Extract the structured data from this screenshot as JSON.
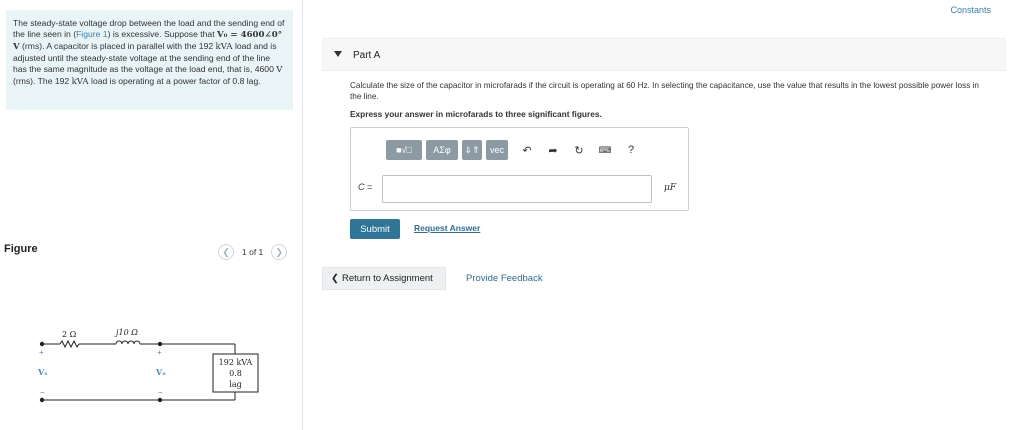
{
  "problem": {
    "text_1": "The steady-state voltage drop between the load and the sending end of the line seen in (",
    "figure_link": "Figure 1",
    "text_2": ") is excessive. Suppose that ",
    "text_3": "V₀ = 4600∠0° V",
    "text_4": " (rms). A capacitor is placed in parallel with the 192 ",
    "text_5": "kVA",
    "text_6": " load and is adjusted until the steady-state voltage at the sending end of the line has the same magnitude as the voltage at the load end, that is, 4600 ",
    "text_7": "V",
    "text_8": " (rms). The 192 ",
    "text_9": "kVA",
    "text_10": " load is operating at a power factor of 0.8 lag."
  },
  "figure": {
    "title": "Figure",
    "pager_text": "1 of 1",
    "prev_icon": "chevron-left-icon",
    "next_icon": "chevron-right-icon",
    "circuit": {
      "r_label": "2 Ω",
      "x_label": "j10 Ω",
      "vs_label": "Vₛ",
      "vo_label": "Vₒ",
      "plus": "+",
      "minus": "−",
      "load_line1": "192 kVA",
      "load_line2": "0.8",
      "load_line3": "lag"
    }
  },
  "header": {
    "constants_link": "Constants"
  },
  "part": {
    "label": "Part A",
    "question": "Calculate the size of the capacitor in microfarads if the circuit is operating at 60 Hz. In selecting the capacitance, use the value that results in the lowest possible power loss in the line.",
    "instruction": "Express your answer in microfarads to three significant figures."
  },
  "toolbar": {
    "templates_label": "■√□",
    "greek_label": "ΑΣφ",
    "arrows_label": "⇓⇑",
    "vec_label": "vec",
    "undo_icon": "undo-icon",
    "redo_icon": "redo-icon",
    "reset_icon": "reset-icon",
    "keyboard_icon": "keyboard-icon",
    "help_label": "?"
  },
  "answer": {
    "var_label": "C",
    "equals": " =",
    "value": "",
    "unit": "μF"
  },
  "actions": {
    "submit": "Submit",
    "request_answer": "Request Answer",
    "return": "Return to Assignment",
    "feedback": "Provide Feedback"
  }
}
